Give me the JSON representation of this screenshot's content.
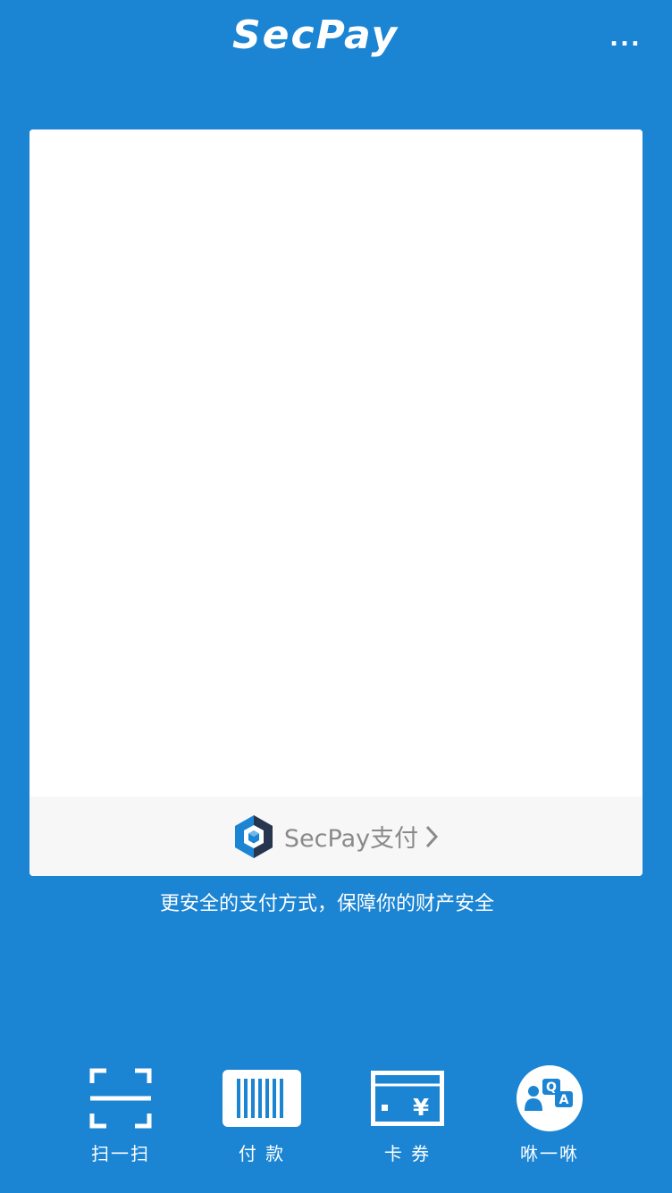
{
  "header": {
    "title": "SecPay",
    "more_label": "..."
  },
  "card": {
    "brand_label": "SecPay支付",
    "brand_icon": "secpay-cube-logo",
    "chevron_icon": "chevron-right-icon"
  },
  "tagline": "更安全的支付方式，保障你的财产安全",
  "nav": [
    {
      "label": "扫一扫",
      "icon": "scan-icon"
    },
    {
      "label": "付 款",
      "icon": "barcode-icon"
    },
    {
      "label": "卡 券",
      "icon": "card-coupon-icon"
    },
    {
      "label": "咻一咻",
      "icon": "qa-icon"
    }
  ],
  "colors": {
    "background": "#1b84d3",
    "card_footer": "#f7f7f7",
    "text_muted": "#8a8a8a",
    "white": "#ffffff"
  }
}
